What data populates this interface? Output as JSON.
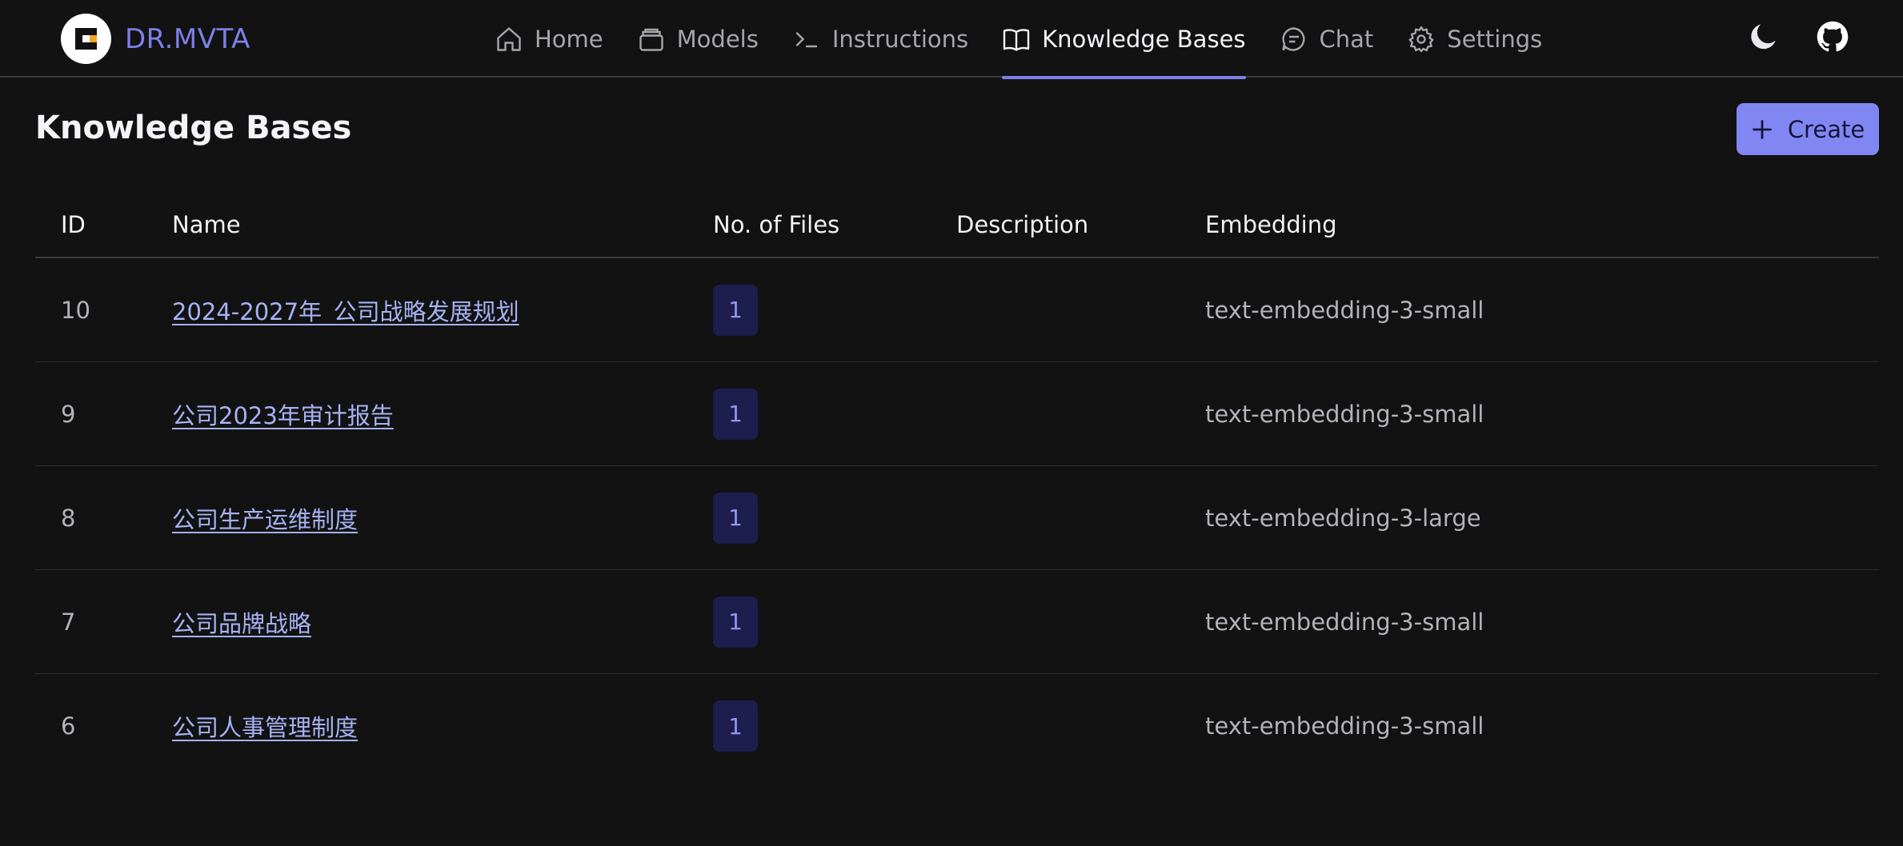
{
  "brand": {
    "name": "DR.MVTA"
  },
  "nav": {
    "items": [
      {
        "label": "Home",
        "icon": "home-icon"
      },
      {
        "label": "Models",
        "icon": "box-icon"
      },
      {
        "label": "Instructions",
        "icon": "terminal-icon"
      },
      {
        "label": "Knowledge Bases",
        "icon": "book-icon",
        "active": true
      },
      {
        "label": "Chat",
        "icon": "chat-bubble-icon"
      },
      {
        "label": "Settings",
        "icon": "gear-icon"
      }
    ]
  },
  "header_actions": {
    "theme_icon": "moon-icon",
    "repo_icon": "github-icon"
  },
  "page": {
    "title": "Knowledge Bases",
    "create_label": "Create"
  },
  "table": {
    "headers": {
      "id": "ID",
      "name": "Name",
      "files": "No. of Files",
      "description": "Description",
      "embedding": "Embedding"
    },
    "rows": [
      {
        "id": "10",
        "name": "2024-2027年_公司战略发展规划",
        "files": "1",
        "description": "",
        "embedding": "text-embedding-3-small"
      },
      {
        "id": "9",
        "name": "公司2023年审计报告",
        "files": "1",
        "description": "",
        "embedding": "text-embedding-3-small"
      },
      {
        "id": "8",
        "name": "公司生产运维制度",
        "files": "1",
        "description": "",
        "embedding": "text-embedding-3-large"
      },
      {
        "id": "7",
        "name": "公司品牌战略",
        "files": "1",
        "description": "",
        "embedding": "text-embedding-3-small"
      },
      {
        "id": "6",
        "name": "公司人事管理制度",
        "files": "1",
        "description": "",
        "embedding": "text-embedding-3-small"
      }
    ]
  },
  "colors": {
    "accent": "#8187f2",
    "background": "#121212",
    "link": "#a7b2f4",
    "badge_bg": "#1d1e4e"
  }
}
